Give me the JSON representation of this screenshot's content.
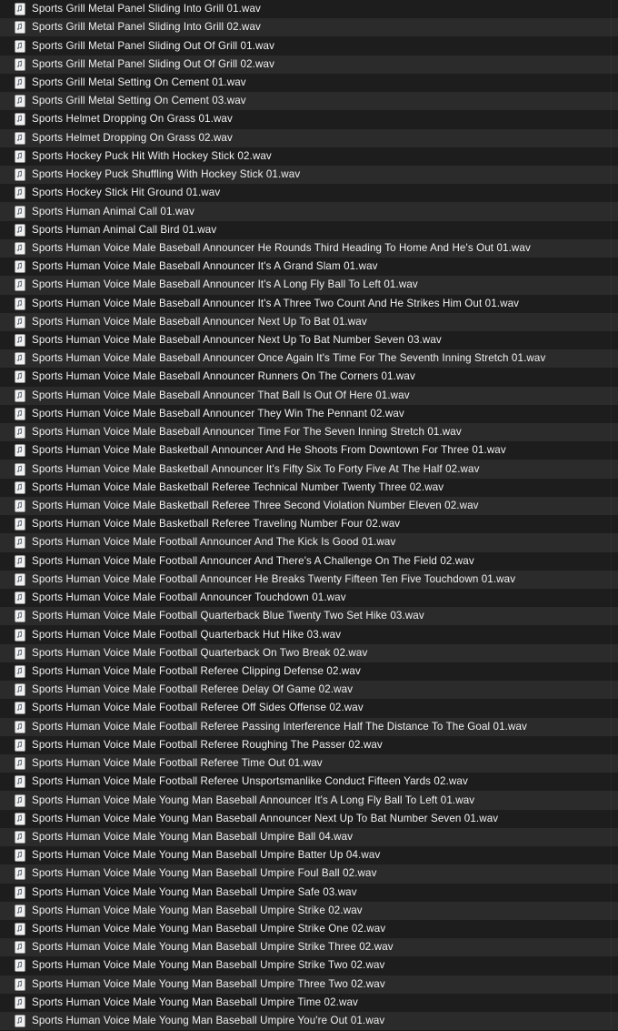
{
  "window": {
    "view_mode": "list",
    "theme": "dark",
    "background_color": "#1c1c1c",
    "row_color_odd": "#1d1d1d",
    "row_color_even": "#2b2b2b",
    "text_color": "#f2f2f2"
  },
  "icons": {
    "audio_file_icon": "music-note-document-icon"
  },
  "files": [
    {
      "name": "Sports Grill Metal Panel Sliding Into Grill 01.wav",
      "icon": "music-note-document-icon"
    },
    {
      "name": "Sports Grill Metal Panel Sliding Into Grill 02.wav",
      "icon": "music-note-document-icon"
    },
    {
      "name": "Sports Grill Metal Panel Sliding Out Of Grill 01.wav",
      "icon": "music-note-document-icon"
    },
    {
      "name": "Sports Grill Metal Panel Sliding Out Of Grill 02.wav",
      "icon": "music-note-document-icon"
    },
    {
      "name": "Sports Grill Metal Setting On Cement 01.wav",
      "icon": "music-note-document-icon"
    },
    {
      "name": "Sports Grill Metal Setting On Cement 03.wav",
      "icon": "music-note-document-icon"
    },
    {
      "name": "Sports Helmet Dropping On Grass 01.wav",
      "icon": "music-note-document-icon"
    },
    {
      "name": "Sports Helmet Dropping On Grass 02.wav",
      "icon": "music-note-document-icon"
    },
    {
      "name": "Sports Hockey Puck Hit With Hockey Stick 02.wav",
      "icon": "music-note-document-icon"
    },
    {
      "name": "Sports Hockey Puck Shuffling With Hockey Stick 01.wav",
      "icon": "music-note-document-icon"
    },
    {
      "name": "Sports Hockey Stick Hit Ground 01.wav",
      "icon": "music-note-document-icon"
    },
    {
      "name": "Sports Human Animal Call 01.wav",
      "icon": "music-note-document-icon"
    },
    {
      "name": "Sports Human Animal Call Bird 01.wav",
      "icon": "music-note-document-icon"
    },
    {
      "name": "Sports Human Voice Male Baseball Announcer He Rounds Third Heading To Home And He's Out 01.wav",
      "icon": "music-note-document-icon"
    },
    {
      "name": "Sports Human Voice Male Baseball Announcer It's A Grand Slam 01.wav",
      "icon": "music-note-document-icon"
    },
    {
      "name": "Sports Human Voice Male Baseball Announcer It's A Long Fly Ball To Left 01.wav",
      "icon": "music-note-document-icon"
    },
    {
      "name": "Sports Human Voice Male Baseball Announcer It's A Three Two Count And He Strikes Him Out 01.wav",
      "icon": "music-note-document-icon"
    },
    {
      "name": "Sports Human Voice Male Baseball Announcer Next Up To Bat 01.wav",
      "icon": "music-note-document-icon"
    },
    {
      "name": "Sports Human Voice Male Baseball Announcer Next Up To Bat Number Seven 03.wav",
      "icon": "music-note-document-icon"
    },
    {
      "name": "Sports Human Voice Male Baseball Announcer Once Again It's Time For The Seventh Inning Stretch 01.wav",
      "icon": "music-note-document-icon"
    },
    {
      "name": "Sports Human Voice Male Baseball Announcer Runners On The Corners 01.wav",
      "icon": "music-note-document-icon"
    },
    {
      "name": "Sports Human Voice Male Baseball Announcer That Ball Is Out Of Here 01.wav",
      "icon": "music-note-document-icon"
    },
    {
      "name": "Sports Human Voice Male Baseball Announcer They Win The Pennant 02.wav",
      "icon": "music-note-document-icon"
    },
    {
      "name": "Sports Human Voice Male Baseball Announcer Time For The Seven Inning Stretch 01.wav",
      "icon": "music-note-document-icon"
    },
    {
      "name": "Sports Human Voice Male Basketball Announcer And He Shoots From Downtown For Three 01.wav",
      "icon": "music-note-document-icon"
    },
    {
      "name": "Sports Human Voice Male Basketball Announcer It's Fifty Six To Forty Five At The Half 02.wav",
      "icon": "music-note-document-icon"
    },
    {
      "name": "Sports Human Voice Male Basketball Referee Technical Number Twenty Three 02.wav",
      "icon": "music-note-document-icon"
    },
    {
      "name": "Sports Human Voice Male Basketball Referee Three Second Violation Number Eleven 02.wav",
      "icon": "music-note-document-icon"
    },
    {
      "name": "Sports Human Voice Male Basketball Referee Traveling Number Four 02.wav",
      "icon": "music-note-document-icon"
    },
    {
      "name": "Sports Human Voice Male Football Announcer And The Kick Is Good 01.wav",
      "icon": "music-note-document-icon"
    },
    {
      "name": "Sports Human Voice Male Football Announcer And There's A Challenge On The Field 02.wav",
      "icon": "music-note-document-icon"
    },
    {
      "name": "Sports Human Voice Male Football Announcer He Breaks Twenty Fifteen Ten Five Touchdown 01.wav",
      "icon": "music-note-document-icon"
    },
    {
      "name": "Sports Human Voice Male Football Announcer Touchdown 01.wav",
      "icon": "music-note-document-icon"
    },
    {
      "name": "Sports Human Voice Male Football Quarterback Blue Twenty Two Set Hike 03.wav",
      "icon": "music-note-document-icon"
    },
    {
      "name": "Sports Human Voice Male Football Quarterback Hut Hike 03.wav",
      "icon": "music-note-document-icon"
    },
    {
      "name": "Sports Human Voice Male Football Quarterback On Two Break 02.wav",
      "icon": "music-note-document-icon"
    },
    {
      "name": "Sports Human Voice Male Football Referee Clipping Defense 02.wav",
      "icon": "music-note-document-icon"
    },
    {
      "name": "Sports Human Voice Male Football Referee Delay Of Game 02.wav",
      "icon": "music-note-document-icon"
    },
    {
      "name": "Sports Human Voice Male Football Referee Off Sides Offense 02.wav",
      "icon": "music-note-document-icon"
    },
    {
      "name": "Sports Human Voice Male Football Referee Passing Interference Half The Distance To The Goal 01.wav",
      "icon": "music-note-document-icon"
    },
    {
      "name": "Sports Human Voice Male Football Referee Roughing The Passer 02.wav",
      "icon": "music-note-document-icon"
    },
    {
      "name": "Sports Human Voice Male Football Referee Time Out 01.wav",
      "icon": "music-note-document-icon"
    },
    {
      "name": "Sports Human Voice Male Football Referee Unsportsmanlike Conduct Fifteen Yards 02.wav",
      "icon": "music-note-document-icon"
    },
    {
      "name": "Sports Human Voice Male Young Man Baseball Announcer It's A Long Fly Ball To Left 01.wav",
      "icon": "music-note-document-icon"
    },
    {
      "name": "Sports Human Voice Male Young Man Baseball Announcer Next Up To Bat Number Seven 01.wav",
      "icon": "music-note-document-icon"
    },
    {
      "name": "Sports Human Voice Male Young Man Baseball Umpire Ball 04.wav",
      "icon": "music-note-document-icon"
    },
    {
      "name": "Sports Human Voice Male Young Man Baseball Umpire Batter Up 04.wav",
      "icon": "music-note-document-icon"
    },
    {
      "name": "Sports Human Voice Male Young Man Baseball Umpire Foul Ball 02.wav",
      "icon": "music-note-document-icon"
    },
    {
      "name": "Sports Human Voice Male Young Man Baseball Umpire Safe 03.wav",
      "icon": "music-note-document-icon"
    },
    {
      "name": "Sports Human Voice Male Young Man Baseball Umpire Strike 02.wav",
      "icon": "music-note-document-icon"
    },
    {
      "name": "Sports Human Voice Male Young Man Baseball Umpire Strike One 02.wav",
      "icon": "music-note-document-icon"
    },
    {
      "name": "Sports Human Voice Male Young Man Baseball Umpire Strike Three 02.wav",
      "icon": "music-note-document-icon"
    },
    {
      "name": "Sports Human Voice Male Young Man Baseball Umpire Strike Two 02.wav",
      "icon": "music-note-document-icon"
    },
    {
      "name": "Sports Human Voice Male Young Man Baseball Umpire Three Two 02.wav",
      "icon": "music-note-document-icon"
    },
    {
      "name": "Sports Human Voice Male Young Man Baseball Umpire Time 02.wav",
      "icon": "music-note-document-icon"
    },
    {
      "name": "Sports Human Voice Male Young Man Baseball Umpire You're Out 01.wav",
      "icon": "music-note-document-icon"
    }
  ]
}
